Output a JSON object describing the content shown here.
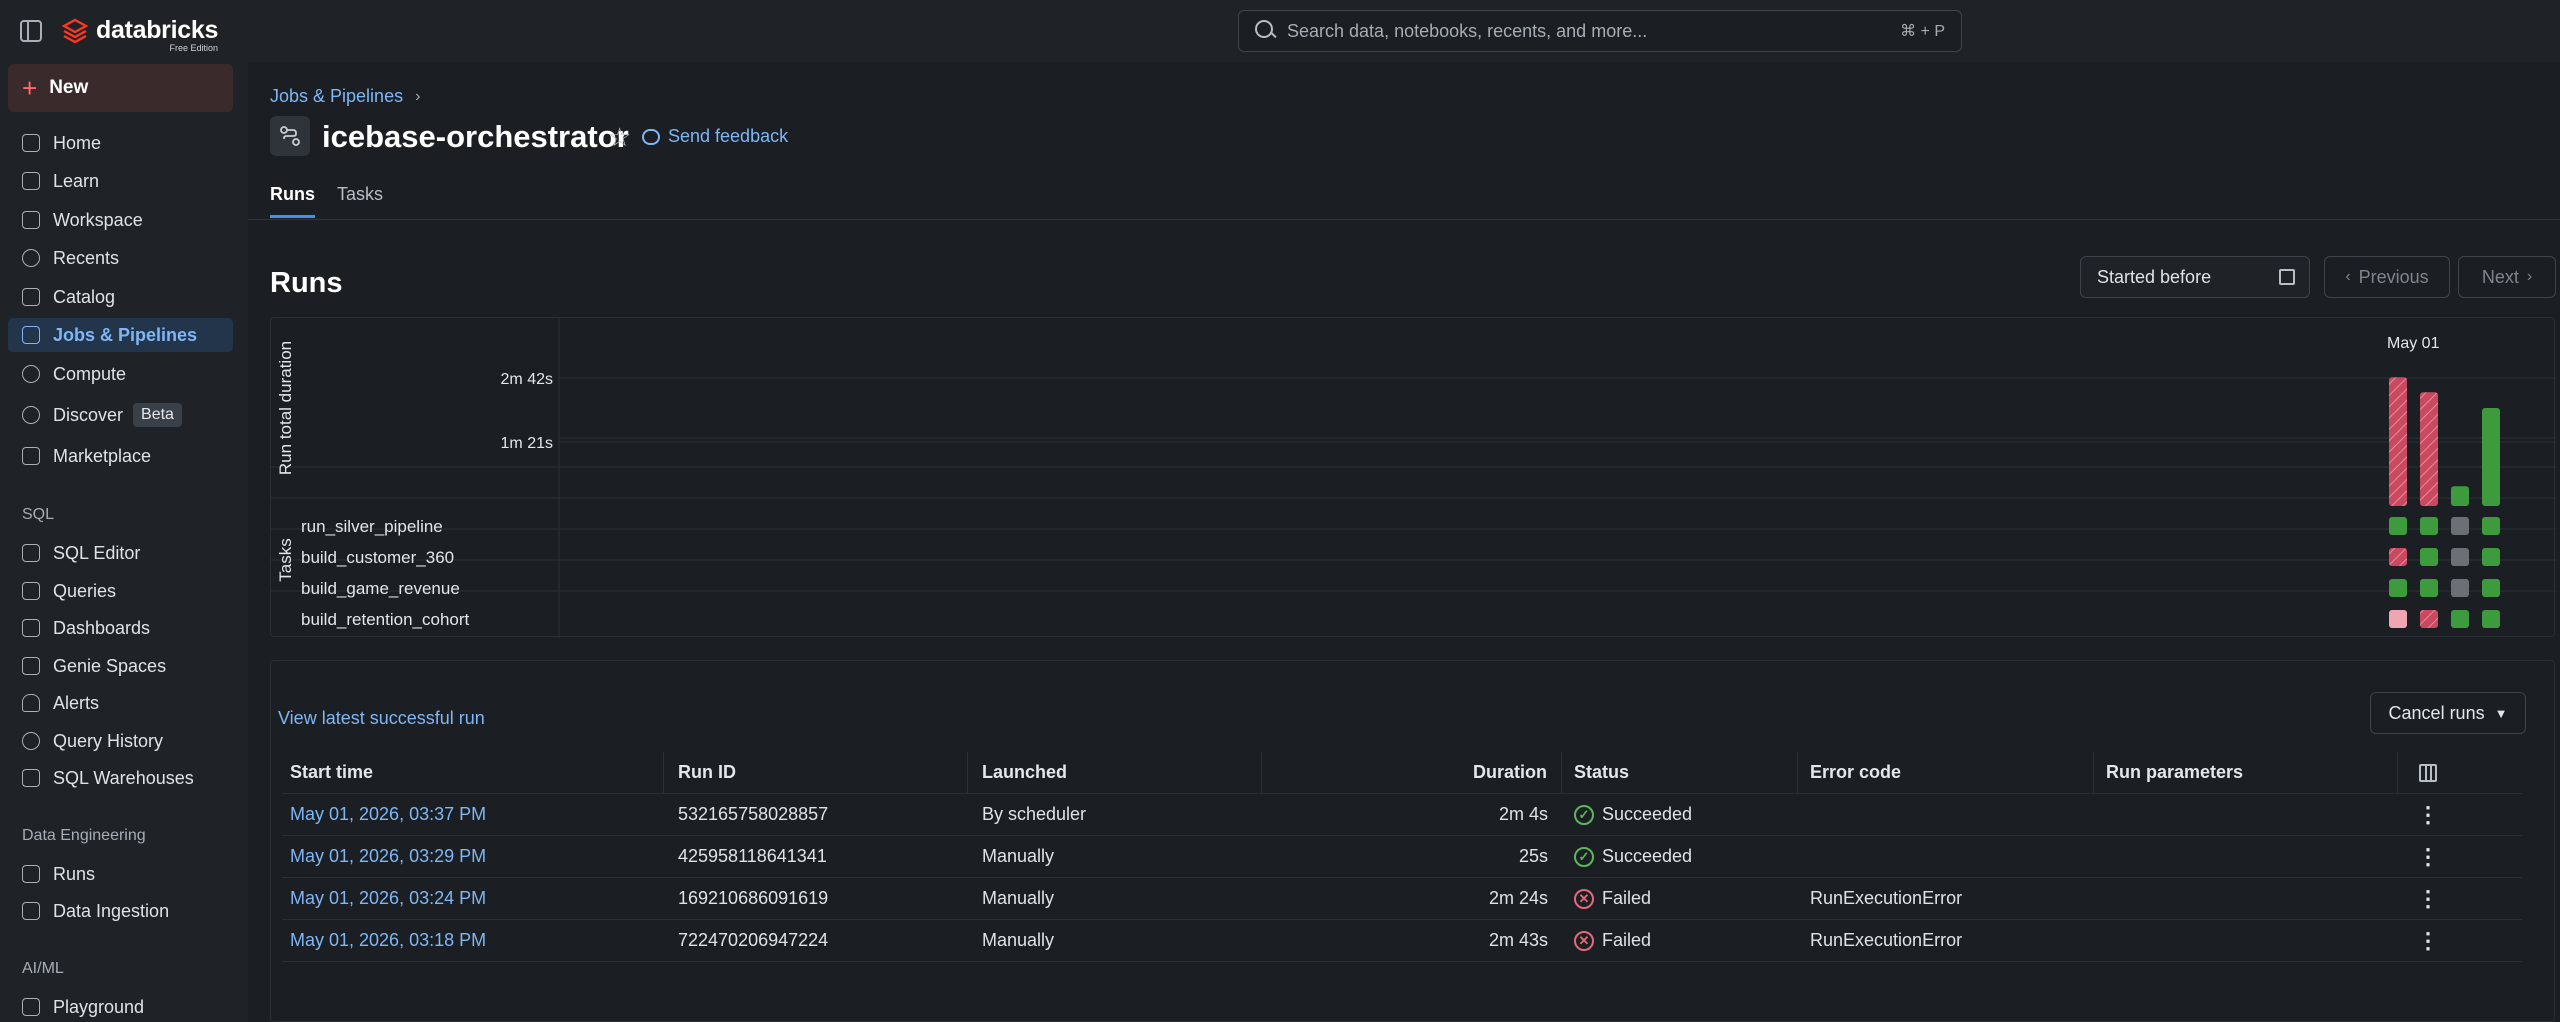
{
  "app": {
    "logo_text": "databricks",
    "edition": "Free Edition",
    "search_placeholder": "Search data, notebooks, recents, and more...",
    "search_shortcut": "⌘ + P"
  },
  "sidebar": {
    "new_label": "New",
    "items": [
      {
        "label": "Home"
      },
      {
        "label": "Learn"
      },
      {
        "label": "Workspace"
      },
      {
        "label": "Recents"
      },
      {
        "label": "Catalog"
      },
      {
        "label": "Jobs & Pipelines"
      },
      {
        "label": "Compute"
      },
      {
        "label": "Discover",
        "badge": "Beta"
      },
      {
        "label": "Marketplace"
      }
    ],
    "sections": [
      {
        "title": "SQL",
        "items": [
          "SQL Editor",
          "Queries",
          "Dashboards",
          "Genie Spaces",
          "Alerts",
          "Query History",
          "SQL Warehouses"
        ]
      },
      {
        "title": "Data Engineering",
        "items": [
          "Runs",
          "Data Ingestion"
        ]
      },
      {
        "title": "AI/ML",
        "items": [
          "Playground"
        ]
      }
    ]
  },
  "page": {
    "breadcrumb": "Jobs & Pipelines",
    "title": "icebase-orchestrator",
    "feedback": "Send feedback",
    "tabs": [
      "Runs",
      "Tasks"
    ]
  },
  "runs": {
    "heading": "Runs",
    "started_before": "Started before",
    "previous": "Previous",
    "next": "Next",
    "latest_link": "View latest successful run",
    "cancel_runs": "Cancel runs",
    "columns": [
      "Start time",
      "Run ID",
      "Launched",
      "Duration",
      "Status",
      "Error code",
      "Run parameters"
    ],
    "rows": [
      {
        "start": "May 01, 2026, 03:37 PM",
        "run_id": "532165758028857",
        "launched": "By scheduler",
        "duration": "2m 4s",
        "status": "Succeeded",
        "error": ""
      },
      {
        "start": "May 01, 2026, 03:29 PM",
        "run_id": "425958118641341",
        "launched": "Manually",
        "duration": "25s",
        "status": "Succeeded",
        "error": ""
      },
      {
        "start": "May 01, 2026, 03:24 PM",
        "run_id": "169210686091619",
        "launched": "Manually",
        "duration": "2m 24s",
        "status": "Failed",
        "error": "RunExecutionError"
      },
      {
        "start": "May 01, 2026, 03:18 PM",
        "run_id": "722470206947224",
        "launched": "Manually",
        "duration": "2m 43s",
        "status": "Failed",
        "error": "RunExecutionError"
      }
    ]
  },
  "chart_data": {
    "type": "bar",
    "ylabel": "Run total duration",
    "xlabel": "",
    "date_label": "May 01",
    "y_ticks": [
      "2m 42s",
      "1m 21s"
    ],
    "ylim_seconds": [
      0,
      180
    ],
    "runs": [
      {
        "duration_s": 163,
        "status": "failed"
      },
      {
        "duration_s": 144,
        "status": "failed"
      },
      {
        "duration_s": 25,
        "status": "succeeded"
      },
      {
        "duration_s": 124,
        "status": "succeeded"
      }
    ],
    "tasks_label": "Tasks",
    "tasks": [
      {
        "name": "run_silver_pipeline",
        "cells": [
          "success",
          "success",
          "skipped",
          "success"
        ]
      },
      {
        "name": "build_customer_360",
        "cells": [
          "failed",
          "success",
          "skipped",
          "success"
        ]
      },
      {
        "name": "build_game_revenue",
        "cells": [
          "success",
          "success",
          "skipped",
          "success"
        ]
      },
      {
        "name": "build_retention_cohort",
        "cells": [
          "failed-light",
          "failed",
          "success",
          "success"
        ]
      }
    ],
    "colors": {
      "success": "#3d9a3d",
      "failed": "#d45a6e",
      "failed_light": "#f0a5b2",
      "skipped": "#6b7076"
    }
  }
}
